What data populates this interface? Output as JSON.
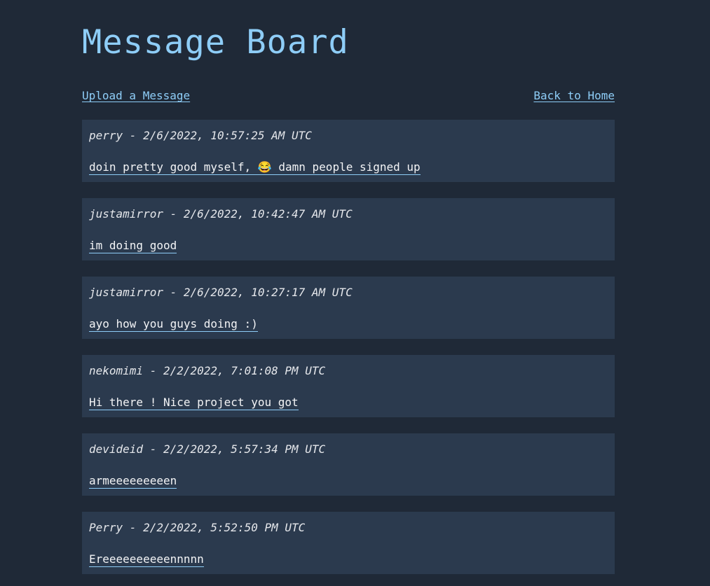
{
  "page": {
    "title": "Message Board"
  },
  "nav": {
    "upload_label": "Upload a Message",
    "home_label": "Back to Home"
  },
  "messages": [
    {
      "author": "perry",
      "timestamp": "2/6/2022, 10:57:25 AM UTC",
      "text": "doin pretty good myself, 😂 damn people signed up"
    },
    {
      "author": "justamirror",
      "timestamp": "2/6/2022, 10:42:47 AM UTC",
      "text": "im doing good"
    },
    {
      "author": "justamirror",
      "timestamp": "2/6/2022, 10:27:17 AM UTC",
      "text": "ayo how you guys doing :)"
    },
    {
      "author": "nekomimi",
      "timestamp": "2/2/2022, 7:01:08 PM UTC",
      "text": "Hi there ! Nice project you got"
    },
    {
      "author": "devideid",
      "timestamp": "2/2/2022, 5:57:34 PM UTC",
      "text": "armeeeeeeeeen"
    },
    {
      "author": "Perry",
      "timestamp": "2/2/2022, 5:52:50 PM UTC",
      "text": "Ereeeeeeeeeennnnn"
    }
  ]
}
